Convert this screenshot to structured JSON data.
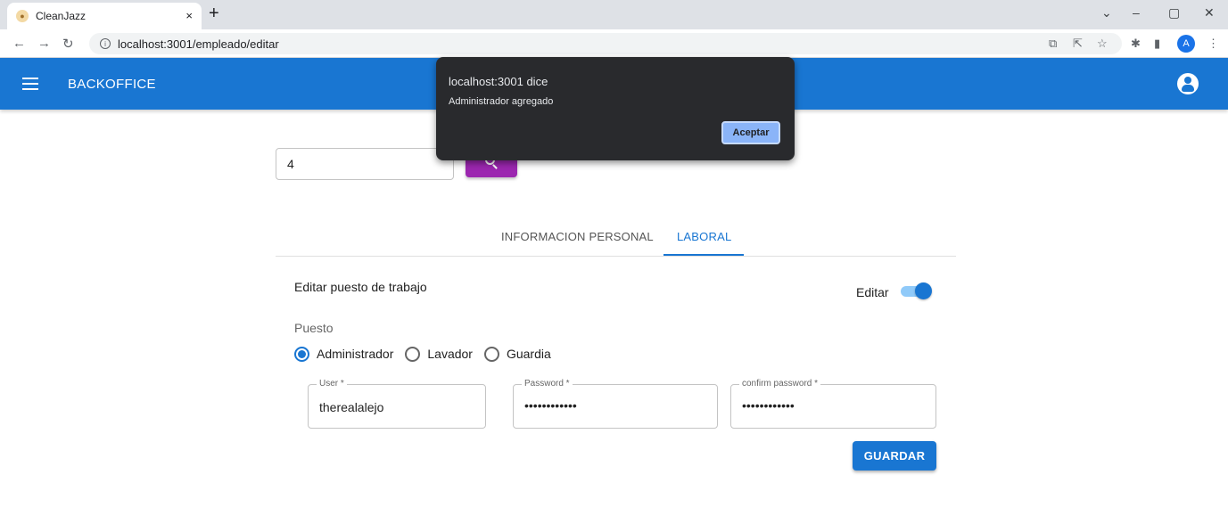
{
  "browser": {
    "tab_title": "CleanJazz",
    "tab_close": "×",
    "new_tab": "+",
    "url": "localhost:3001/empleado/editar",
    "profile_initial": "A"
  },
  "app": {
    "title": "BACKOFFICE",
    "accent_color": "#1976d2",
    "search_button_color": "#9c27b0"
  },
  "search": {
    "value": "4"
  },
  "tabs": [
    {
      "label": "INFORMACION PERSONAL",
      "active": false
    },
    {
      "label": "LABORAL",
      "active": true
    }
  ],
  "form": {
    "section_title": "Editar puesto de trabajo",
    "edit_toggle_label": "Editar",
    "edit_toggle_on": true,
    "puesto_label": "Puesto",
    "puesto_options": [
      {
        "label": "Administrador",
        "selected": true
      },
      {
        "label": "Lavador",
        "selected": false
      },
      {
        "label": "Guardia",
        "selected": false
      }
    ],
    "fields": {
      "user": {
        "label": "User *",
        "value": "therealalejo"
      },
      "password": {
        "label": "Password *",
        "value": "••••••••••••"
      },
      "confirm_password": {
        "label": "confirm password *",
        "value": "••••••••••••"
      }
    },
    "save_label": "GUARDAR"
  },
  "dialog": {
    "title": "localhost:3001 dice",
    "message": "Administrador agregado",
    "ok_label": "Aceptar"
  }
}
